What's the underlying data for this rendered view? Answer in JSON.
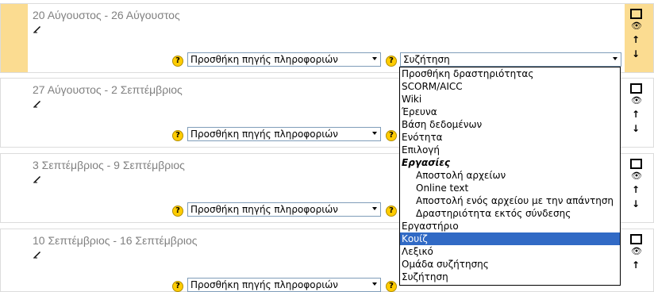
{
  "weeks": [
    {
      "title": "20 Αύγουστος - 26 Αύγουστος",
      "current": true
    },
    {
      "title": "27 Αύγουστος - 2 Σεπτέμβριος",
      "current": false
    },
    {
      "title": "3 Σεπτέμβριος - 9 Σεπτέμβριος",
      "current": false
    },
    {
      "title": "10 Σεπτέμβριος - 16 Σεπτέμβριος",
      "current": false
    }
  ],
  "controls": {
    "help": "?",
    "resource_select": "Προσθήκη πηγής πληροφοριών",
    "activity_select_value": "Συζήτηση",
    "up_arrow": "↑",
    "down_arrow": "↓",
    "eye": "👁"
  },
  "activity_options": [
    {
      "label": "Προσθήκη δραστηριότητας",
      "kind": "normal"
    },
    {
      "label": "SCORM/AICC",
      "kind": "normal"
    },
    {
      "label": "Wiki",
      "kind": "normal"
    },
    {
      "label": "Έρευνα",
      "kind": "normal"
    },
    {
      "label": "Βάση δεδομένων",
      "kind": "normal"
    },
    {
      "label": "Ενότητα",
      "kind": "normal"
    },
    {
      "label": "Επιλογή",
      "kind": "normal"
    },
    {
      "label": "Εργασίες",
      "kind": "group"
    },
    {
      "label": "Αποστολή αρχείων",
      "kind": "indent"
    },
    {
      "label": "Online text",
      "kind": "indent"
    },
    {
      "label": "Αποστολή ενός αρχείου με την απάντηση",
      "kind": "indent"
    },
    {
      "label": "Δραστηριότητα εκτός σύνδεσης",
      "kind": "indent"
    },
    {
      "label": "Εργαστήριο",
      "kind": "normal"
    },
    {
      "label": "Κουίζ",
      "kind": "selected"
    },
    {
      "label": "Λεξικό",
      "kind": "normal"
    },
    {
      "label": "Ομάδα συζήτησης",
      "kind": "normal"
    },
    {
      "label": "Συζήτηση",
      "kind": "normal"
    }
  ],
  "colors": {
    "current_week": "#fbdc91",
    "highlight": "#316ac5"
  }
}
